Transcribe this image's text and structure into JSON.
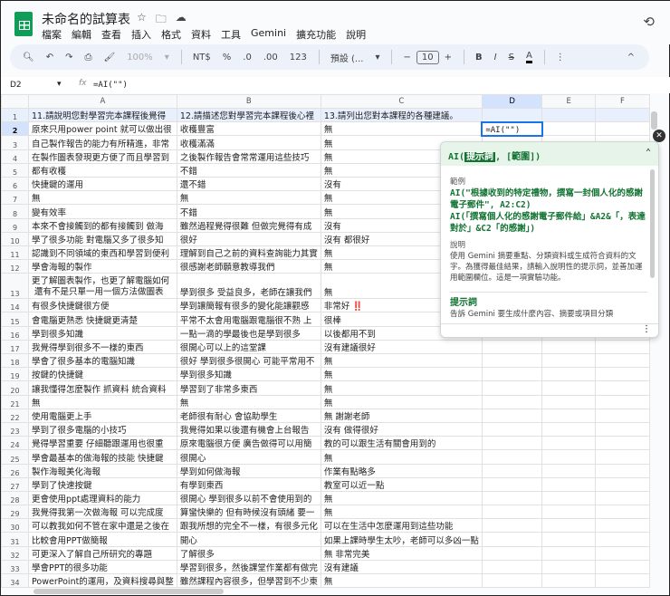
{
  "app": {
    "title": "未命名的試算表",
    "menu": [
      "檔案",
      "編輯",
      "查看",
      "插入",
      "格式",
      "資料",
      "工具",
      "Gemini",
      "擴充功能",
      "說明"
    ]
  },
  "toolbar": {
    "zoom": "100%",
    "currency": "NT$",
    "percent": "%",
    "dec_less": ".0",
    "dec_more": ".00",
    "format": "123",
    "font": "預設 (...",
    "minus": "−",
    "font_size": "10",
    "plus": "+",
    "bold": "B",
    "italic": "I",
    "strike": "S",
    "color": "A"
  },
  "formula_bar": {
    "cell_ref": "D2",
    "formula": "=AI(\"\")"
  },
  "columns": [
    "A",
    "B",
    "C",
    "D",
    "E",
    "F"
  ],
  "rows": [
    [
      "11.請說明您對學習完本課程後覺得",
      "12.請描述您對學習完本課程後心裡",
      "13.請列出您對本課程的各種建議。",
      ""
    ],
    [
      "原來只用power point 就可以做出很",
      "收穫豐富",
      "無",
      "=AI(\"\")"
    ],
    [
      "自己製作報告的能力有所精進，非常",
      "收穫滿滿",
      "無",
      ""
    ],
    [
      "在製作圖表發現更方便了而且學習到",
      "之後製作報告會常常運用這些技巧",
      "無",
      ""
    ],
    [
      "都有收穫",
      "不錯",
      "無",
      ""
    ],
    [
      "快捷鍵的運用",
      "還不錯",
      "沒有",
      ""
    ],
    [
      "無",
      "無",
      "無",
      ""
    ],
    [
      "變有效率",
      "不錯",
      "無",
      ""
    ],
    [
      "本來不會接觸到的都有接觸到 做海",
      "雖然過程覺得很難 但做完覺得有成",
      "沒有",
      ""
    ],
    [
      "學了很多功能 對電腦又多了很多知",
      "很好",
      "沒有 都很好",
      ""
    ],
    [
      "認識到不同領域的東西和學習到便利",
      "理解到自己之前的資料查詢能力其實",
      "無",
      ""
    ],
    [
      "學會海報的製作",
      "很感謝老師願意教導我們",
      "無",
      ""
    ],
    [
      "更了解圖表製作，也更了解電腦如何\n 還有不是只單一用一個方法做圖表",
      "學到很多 受益良多，老師在讓我們",
      "無",
      ""
    ],
    [
      "有很多快捷鍵很方便",
      "學到讓簡報有很多的變化能讓觀感",
      "非常好 ‼️",
      ""
    ],
    [
      "會電腦更熟悉 快捷鍵更清楚",
      "平常不太會用電腦跟電腦很不熟 上",
      "很棒",
      ""
    ],
    [
      "學到很多知識",
      "一點一滴的學最後也是學到很多",
      "以後都用不到",
      ""
    ],
    [
      "我覺得學到很多不一樣的東西",
      "很開心可以上的這堂課",
      "沒有建議很好",
      ""
    ],
    [
      "學會了很多基本的電腦知識",
      "很好 學到很多很開心 可能平常用不",
      "無",
      ""
    ],
    [
      "按鍵的快捷鍵",
      "學到很多知識",
      "無",
      ""
    ],
    [
      "讓我懂得怎麼製作 抓資料 統合資料",
      "學習到了非常多東西",
      "無",
      ""
    ],
    [
      "無",
      "無",
      "無",
      ""
    ],
    [
      "使用電腦更上手",
      "老師很有耐心 會協助學生",
      "無 謝謝老師",
      ""
    ],
    [
      "學到了很多電腦的小技巧",
      "我覺得如果以後還有機會上台報告",
      "沒有 做得很好",
      ""
    ],
    [
      "覺得學習重要 仔細聽跟運用也很重",
      "原來電腦很方便 廣告做得可以用簡",
      "教的可以跟生活有關會用到的",
      ""
    ],
    [
      "學會最基本的做海報的技能 快捷鍵",
      "很開心",
      "無",
      ""
    ],
    [
      "製作海報美化海報",
      "學到如何做海報",
      "作業有點略多",
      ""
    ],
    [
      "學到了快速按鍵",
      "有學到東西",
      "教室可以近一點",
      ""
    ],
    [
      "更會使用ppt處理資料的能力",
      "很開心 學到很多以前不會使用到的",
      "無",
      ""
    ],
    [
      "我覺得我第一次做海報 可以完成度",
      "算蠻快樂的 但有時候沒有頭緒 要一",
      "無",
      ""
    ],
    [
      "可以教我如何不管在家中還是之後在",
      "跟我所想的完全不一樣，有很多元化",
      "可以在生活中怎麼運用到這些功能",
      ""
    ],
    [
      "比較會用PPT做簡報",
      "開心",
      "如果上課時學生太吵，老師可以多凶一點",
      ""
    ],
    [
      "可更深入了解自己所研究的專題",
      "了解很多",
      "無 非常完美",
      ""
    ],
    [
      "學會PPT的很多功能",
      "學習到很多，然後課堂作業都有做完",
      "沒有建議",
      ""
    ],
    [
      "PowerPoint的運用，及資料搜尋與整",
      "雖然課程內容很多，但學習到不少東",
      "無",
      ""
    ]
  ],
  "gemini_help": {
    "signature_pre": "AI(",
    "signature_param": "提示詞",
    "signature_post": ", [範圍])",
    "examples_label": "範例",
    "example1": "AI(\"根據收到的特定禮物，撰寫一封個人化的感謝電子郵件\", A2:C2)",
    "example2": "AI(「撰寫個人化的感謝電子郵件給」&A2&「，表達對於」&C2「的感謝」)",
    "desc_label": "說明",
    "desc": "使用 Gemini 摘要重點、分類資料或生成符合資料的文字。為獲得最佳結果，請輸入說明性的提示詞，並善加運用範圍欄位。這是一項實驗功能。",
    "prompt_label": "提示詞",
    "prompt_desc": "告訴 Gemini 要生成什麼內容、摘要或項目分類"
  }
}
